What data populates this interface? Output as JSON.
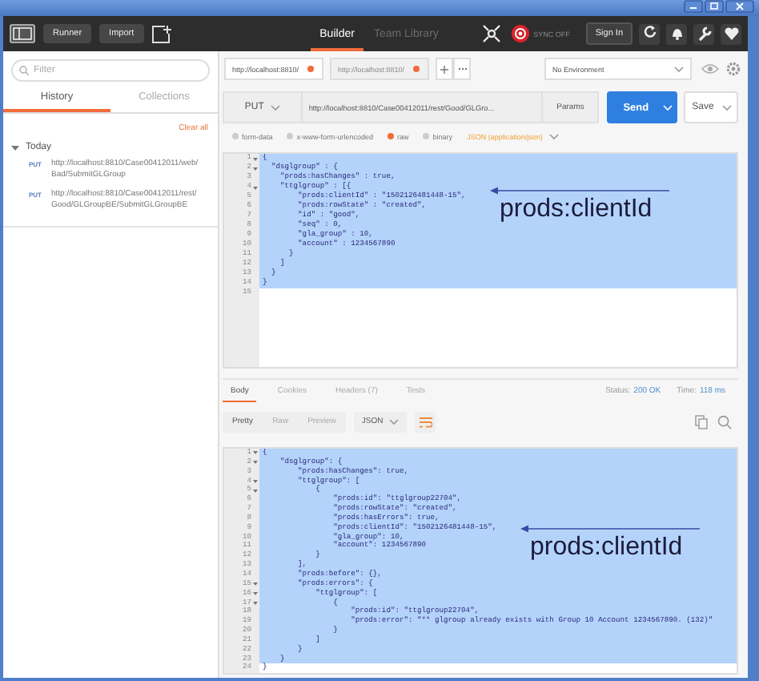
{
  "toolbar": {
    "buttons": [
      {
        "label": "Runner"
      },
      {
        "label": "Import"
      }
    ],
    "tabs": [
      {
        "label": "Builder",
        "selected": true
      },
      {
        "label": "Team Library",
        "selected": false
      }
    ],
    "sync_status": "SYNC OFF",
    "sign_in": "Sign In"
  },
  "sidebar": {
    "filter": {
      "placeholder": "Filter"
    },
    "tabs": [
      {
        "label": "History",
        "selected": true
      },
      {
        "label": "Collections",
        "selected": false
      }
    ],
    "clear_all": "Clear all",
    "groups": [
      {
        "label": "Today",
        "expanded": true,
        "items": [
          {
            "method": "PUT",
            "url": "http://localhost:8810/Case00412011/web/Bad/SubmitGLGroup"
          },
          {
            "method": "PUT",
            "url": "http://localhost:8810/Case00412011/rest/Good/GLGroupBE/SubmitGLGroupBE"
          }
        ]
      }
    ]
  },
  "request_tabs": [
    {
      "url": "http://localhost:8810/",
      "selected": true,
      "unsaved": true
    },
    {
      "url": "http://localhost:8810/",
      "selected": false,
      "unsaved": true
    }
  ],
  "environment": "No Environment",
  "request": {
    "method": "PUT",
    "url": "http://localhost:8810/Case00412011/rest/Good/GLGro...",
    "params": "Params",
    "send": "Send",
    "save": "Save"
  },
  "body_modes": [
    {
      "label": "form-data",
      "selected": false
    },
    {
      "label": "x-www-form-urlencoded",
      "selected": false
    },
    {
      "label": "raw",
      "selected": true
    },
    {
      "label": "binary",
      "selected": false
    }
  ],
  "body_type": "JSON (application/json)",
  "request_body": {
    "annotation": "prods:clientId",
    "lines": [
      {
        "number": "1",
        "text": "{",
        "foldable": true,
        "highlighted": true
      },
      {
        "number": "2",
        "text": "  \"dsglgroup\" : {",
        "foldable": true,
        "highlighted": true
      },
      {
        "number": "3",
        "text": "    \"prods:hasChanges\" : true,",
        "foldable": false,
        "highlighted": true
      },
      {
        "number": "4",
        "text": "    \"ttglgroup\" : [{",
        "foldable": true,
        "highlighted": true
      },
      {
        "number": "5",
        "text": "        \"prods:clientId\" : \"1502126481448-15\",",
        "foldable": false,
        "highlighted": true
      },
      {
        "number": "6",
        "text": "        \"prods:rowState\" : \"created\",",
        "foldable": false,
        "highlighted": true
      },
      {
        "number": "7",
        "text": "        \"id\" : \"good\",",
        "foldable": false,
        "highlighted": true
      },
      {
        "number": "8",
        "text": "        \"seq\" : 0,",
        "foldable": false,
        "highlighted": true
      },
      {
        "number": "9",
        "text": "        \"gla_group\" : 10,",
        "foldable": false,
        "highlighted": true
      },
      {
        "number": "10",
        "text": "        \"account\" : 1234567890",
        "foldable": false,
        "highlighted": true
      },
      {
        "number": "11",
        "text": "      }",
        "foldable": false,
        "highlighted": true
      },
      {
        "number": "12",
        "text": "    ]",
        "foldable": false,
        "highlighted": true
      },
      {
        "number": "13",
        "text": "  }",
        "foldable": false,
        "highlighted": true
      },
      {
        "number": "14",
        "text": "}",
        "foldable": false,
        "highlighted": true
      },
      {
        "number": "15",
        "foldable": false,
        "highlighted": false
      }
    ]
  },
  "response": {
    "tabs": [
      {
        "label": "Body",
        "selected": true
      },
      {
        "label": "Cookies",
        "selected": false
      },
      {
        "label": "Headers (7)",
        "selected": false
      },
      {
        "label": "Tests",
        "selected": false
      }
    ],
    "status_label": "Status:",
    "status": "200 OK",
    "time_label": "Time:",
    "time": "118 ms",
    "views": [
      {
        "label": "Pretty",
        "selected": true
      },
      {
        "label": "Raw",
        "selected": false
      },
      {
        "label": "Preview",
        "selected": false
      }
    ],
    "format": "JSON",
    "annotation": "prods:clientId",
    "lines": [
      {
        "number": "1",
        "text": "{",
        "foldable": true,
        "highlighted": true
      },
      {
        "number": "2",
        "text": "    \"dsglgroup\": {",
        "foldable": true,
        "highlighted": true
      },
      {
        "number": "3",
        "text": "        \"prods:hasChanges\": true,",
        "foldable": false,
        "highlighted": true
      },
      {
        "number": "4",
        "text": "        \"ttglgroup\": [",
        "foldable": true,
        "highlighted": true
      },
      {
        "number": "5",
        "text": "            {",
        "foldable": true,
        "highlighted": true
      },
      {
        "number": "6",
        "text": "                \"prods:id\": \"ttglgroup22704\",",
        "foldable": false,
        "highlighted": true
      },
      {
        "number": "7",
        "text": "                \"prods:rowState\": \"created\",",
        "foldable": false,
        "highlighted": true
      },
      {
        "number": "8",
        "text": "                \"prods:hasErrors\": true,",
        "foldable": false,
        "highlighted": true
      },
      {
        "number": "9",
        "text": "                \"prods:clientId\": \"1502126481448-15\",",
        "foldable": false,
        "highlighted": true
      },
      {
        "number": "10",
        "text": "                \"gla_group\": 10,",
        "foldable": false,
        "highlighted": true
      },
      {
        "number": "11",
        "text": "                \"account\": 1234567890",
        "foldable": false,
        "highlighted": true
      },
      {
        "number": "12",
        "text": "            }",
        "foldable": false,
        "highlighted": true
      },
      {
        "number": "13",
        "text": "        ],",
        "foldable": false,
        "highlighted": true
      },
      {
        "number": "14",
        "text": "        \"prods:before\": {},",
        "foldable": false,
        "highlighted": true
      },
      {
        "number": "15",
        "text": "        \"prods:errors\": {",
        "foldable": true,
        "highlighted": true
      },
      {
        "number": "16",
        "text": "            \"ttglgroup\": [",
        "foldable": true,
        "highlighted": true
      },
      {
        "number": "17",
        "text": "                {",
        "foldable": true,
        "highlighted": true
      },
      {
        "number": "18",
        "text": "                    \"prods:id\": \"ttglgroup22704\",",
        "foldable": false,
        "highlighted": true
      },
      {
        "number": "19",
        "text": "                    \"prods:error\": \"** glgroup already exists with Group 10 Account 1234567890. (132)\"",
        "foldable": false,
        "highlighted": true
      },
      {
        "number": "20",
        "text": "                }",
        "foldable": false,
        "highlighted": true
      },
      {
        "number": "21",
        "text": "            ]",
        "foldable": false,
        "highlighted": true
      },
      {
        "number": "22",
        "text": "        }",
        "foldable": false,
        "highlighted": true
      },
      {
        "number": "23",
        "text": "    }",
        "foldable": false,
        "highlighted": true
      },
      {
        "number": "24",
        "text": "}",
        "foldable": false,
        "highlighted": false
      }
    ]
  }
}
